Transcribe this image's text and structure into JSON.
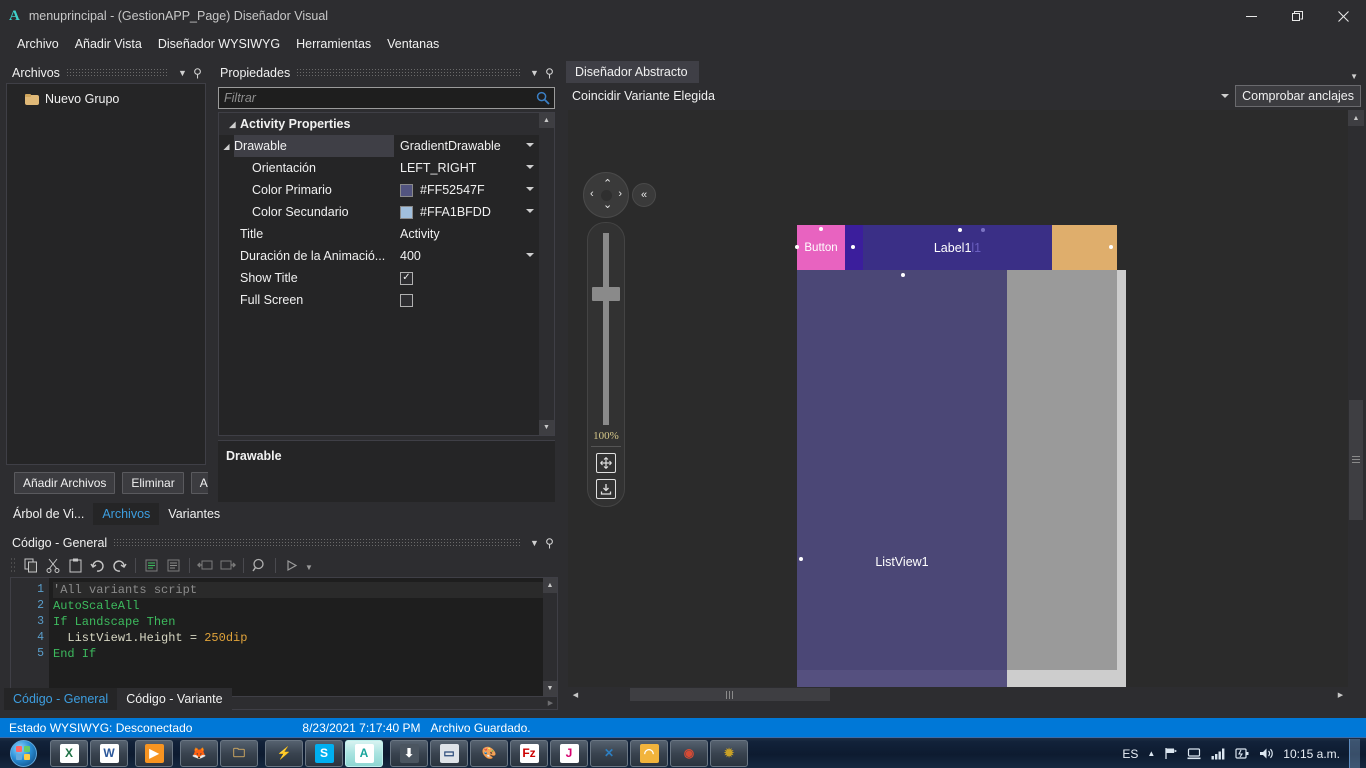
{
  "window": {
    "logo": "A",
    "title": "menuprincipal - (GestionAPP_Page) Diseñador Visual",
    "minimize": "—",
    "restore": "❐",
    "close": "✕"
  },
  "menubar": {
    "items": [
      {
        "label": "Archivo"
      },
      {
        "label": "Añadir Vista"
      },
      {
        "label": "Diseñador WYSIWYG"
      },
      {
        "label": "Herramientas"
      },
      {
        "label": "Ventanas"
      }
    ]
  },
  "archivos_panel": {
    "title": "Archivos",
    "tree": [
      {
        "label": "Nuevo Grupo",
        "icon": "folder-icon"
      }
    ],
    "buttons": [
      {
        "label": "Añadir Archivos"
      },
      {
        "label": "Eliminar"
      },
      {
        "label": "A"
      }
    ],
    "tabs": [
      {
        "label": "Árbol de Vi...",
        "active": false
      },
      {
        "label": "Archivos",
        "active": true
      },
      {
        "label": "Variantes",
        "active": false
      }
    ]
  },
  "properties_panel": {
    "title": "Propiedades",
    "filter_placeholder": "Filtrar",
    "filter_value": "",
    "search_icon": "search-icon",
    "rows": [
      {
        "kind": "category",
        "expander": "▲",
        "name": "Activity Properties",
        "value": ""
      },
      {
        "kind": "parent",
        "expander": "▲",
        "name": "Drawable",
        "value": "GradientDrawable",
        "dropdown": true,
        "selected": true
      },
      {
        "kind": "child",
        "name": "Orientación",
        "value": "LEFT_RIGHT",
        "dropdown": true
      },
      {
        "kind": "child",
        "name": "Color Primario",
        "value": "#FF52547F",
        "dropdown": true,
        "swatch": "#52547F"
      },
      {
        "kind": "child",
        "name": "Color Secundario",
        "value": "#FFA1BFDD",
        "dropdown": true,
        "swatch": "#A1BFDD"
      },
      {
        "kind": "plain",
        "name": "Title",
        "value": "Activity"
      },
      {
        "kind": "plain",
        "name": "Duración de la Animació...",
        "value": "400",
        "dropdown": true
      },
      {
        "kind": "checkbox",
        "name": "Show Title",
        "checked": true
      },
      {
        "kind": "checkbox",
        "name": "Full Screen",
        "checked": false
      }
    ],
    "description_title": "Drawable"
  },
  "code_panel": {
    "title": "Código - General",
    "toolbar": [
      {
        "name": "copy-icon",
        "glyph": "❐"
      },
      {
        "name": "cut-icon",
        "glyph": "✂"
      },
      {
        "name": "paste-icon",
        "glyph": "📋"
      },
      {
        "name": "undo-icon",
        "glyph": "↺"
      },
      {
        "name": "redo-icon",
        "glyph": "↻"
      },
      {
        "name": "comment-icon",
        "glyph": "▤"
      },
      {
        "name": "uncomment-icon",
        "glyph": "▥"
      },
      {
        "name": "outdent-icon",
        "glyph": "⇤"
      },
      {
        "name": "indent-icon",
        "glyph": "⇥"
      },
      {
        "name": "find-icon",
        "glyph": "🔍"
      },
      {
        "name": "run-icon",
        "glyph": "▷"
      }
    ],
    "lines": [
      {
        "n": "1",
        "tokens": [
          {
            "t": "'All variants script",
            "c": "comment"
          }
        ]
      },
      {
        "n": "2",
        "tokens": [
          {
            "t": "AutoScaleAll",
            "c": "kw"
          }
        ]
      },
      {
        "n": "3",
        "tokens": [
          {
            "t": "If Landscape Then",
            "c": "kw"
          }
        ]
      },
      {
        "n": "4",
        "tokens": [
          {
            "t": "  ",
            "c": "op"
          },
          {
            "t": "ListView1.Height",
            "c": "id"
          },
          {
            "t": " = ",
            "c": "op"
          },
          {
            "t": "250dip",
            "c": "num"
          }
        ]
      },
      {
        "n": "5",
        "tokens": [
          {
            "t": "End If",
            "c": "kw"
          }
        ]
      }
    ],
    "tabs": [
      {
        "label": "Código - General",
        "active": true
      },
      {
        "label": "Código - Variante",
        "active": false
      }
    ]
  },
  "designer": {
    "doc_tab": "Diseñador Abstracto",
    "variant_label": "Coincidir Variante Elegida",
    "anchor_button": "Comprobar anclajes",
    "navpad": {
      "up": "⌃",
      "down": "⌄",
      "left": "‹",
      "right": "›",
      "collapse": "«"
    },
    "zoom": {
      "value": "100%",
      "fit_icon": "move-fit-icon",
      "save_icon": "save-layout-icon"
    },
    "device": {
      "button_label": "Button",
      "label_text": "Label1",
      "label_ghost": "l1",
      "listview_label": "ListView1"
    }
  },
  "statusbar": {
    "wysiwyg": "Estado WYSIWYG: Desconectado",
    "datetime": "8/23/2021 7:17:40 PM",
    "message": "Archivo Guardado."
  },
  "taskbar": {
    "start": "start-orb",
    "items": [
      {
        "name": "excel",
        "glyph": "X",
        "bg": "#ffffff",
        "fg": "#1e7145",
        "sep": false
      },
      {
        "name": "word",
        "glyph": "W",
        "bg": "#ffffff",
        "fg": "#2b579a",
        "sep": false
      },
      {
        "name": "media-player",
        "glyph": "▶",
        "bg": "#f79421",
        "fg": "#ffffff",
        "sep": true
      },
      {
        "name": "firefox",
        "glyph": "🦊",
        "bg": "transparent",
        "fg": "#ff6611",
        "sep": true
      },
      {
        "name": "file-explorer",
        "glyph": "🗀",
        "bg": "transparent",
        "fg": "#e8b964",
        "sep": false
      },
      {
        "name": "lightning-app",
        "glyph": "⚡",
        "bg": "transparent",
        "fg": "#6fd0ff",
        "sep": true
      },
      {
        "name": "skype",
        "glyph": "S",
        "bg": "#00aff0",
        "fg": "#ffffff",
        "sep": false
      },
      {
        "name": "b4a-designer",
        "glyph": "A",
        "bg": "#ffffff",
        "fg": "#19a59c",
        "sep": false,
        "active": true
      },
      {
        "name": "download-manager",
        "glyph": "⬇",
        "bg": "#4b5560",
        "fg": "#ffffff",
        "sep": true
      },
      {
        "name": "notepad",
        "glyph": "▭",
        "bg": "#dfe3e8",
        "fg": "#2b4a7a",
        "sep": false
      },
      {
        "name": "paint",
        "glyph": "🎨",
        "bg": "transparent",
        "fg": "#c9d6e0",
        "sep": false
      },
      {
        "name": "filezilla",
        "glyph": "Fz",
        "bg": "#ffffff",
        "fg": "#cc0000",
        "sep": false
      },
      {
        "name": "j-app",
        "glyph": "J",
        "bg": "#ffffff",
        "fg": "#d6006e",
        "sep": false
      },
      {
        "name": "vscode",
        "glyph": "✕",
        "bg": "transparent",
        "fg": "#2d7fc1",
        "sep": false
      },
      {
        "name": "orange-app",
        "glyph": "◠",
        "bg": "#f2b43c",
        "fg": "#ffffff",
        "sep": false
      },
      {
        "name": "chrome",
        "glyph": "◉",
        "bg": "transparent",
        "fg": "#d64b35",
        "sep": false
      },
      {
        "name": "misc-app",
        "glyph": "✹",
        "bg": "transparent",
        "fg": "#c9a227",
        "sep": false
      }
    ],
    "tray": {
      "language": "ES",
      "show_hidden": "▲",
      "flag_icon": "flag-icon",
      "network_icon": "network-icon",
      "signal_icon": "signal-icon",
      "battery_icon": "battery-icon",
      "volume_icon": "volume-icon",
      "clock": "10:15 a.m."
    }
  }
}
